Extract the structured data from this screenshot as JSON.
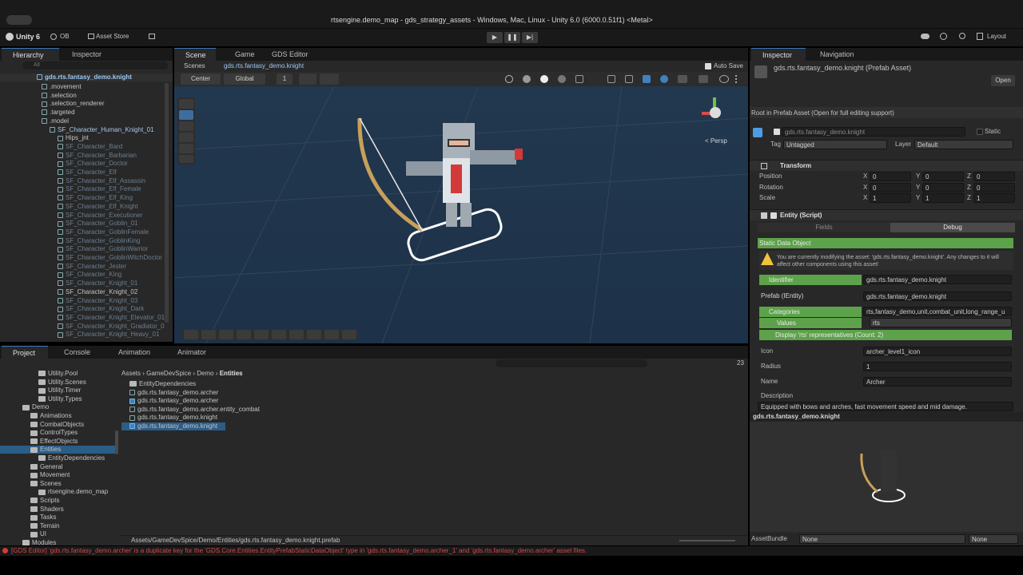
{
  "window": {
    "title": "rtsengine.demo_map - gds_strategy_assets - Windows, Mac, Linux - Unity 6.0 (6000.0.51f1) <Metal>"
  },
  "toolbar": {
    "unity_label": "Unity 6",
    "account": "OB",
    "asset_store": "Asset Store",
    "layout": "Layout"
  },
  "left_tabs": {
    "hierarchy": "Hierarchy",
    "inspector": "Inspector"
  },
  "hierarchy": {
    "search_placeholder": "All",
    "root": "gds.rts.fantasy_demo.knight",
    "items": [
      {
        "label": ".movement",
        "indent": 1,
        "style": "normal"
      },
      {
        "label": ".selection",
        "indent": 1,
        "style": "normal"
      },
      {
        "label": ".selection_renderer",
        "indent": 1,
        "style": "normal"
      },
      {
        "label": ".targeted",
        "indent": 1,
        "style": "normal"
      },
      {
        "label": ".model",
        "indent": 1,
        "style": "normal"
      },
      {
        "label": "SF_Character_Human_Knight_01",
        "indent": 2,
        "style": "blue"
      },
      {
        "label": "Hips_jnt",
        "indent": 3,
        "style": "normal"
      },
      {
        "label": "SF_Character_Bard",
        "indent": 3,
        "style": "faded"
      },
      {
        "label": "SF_Character_Barbarian",
        "indent": 3,
        "style": "faded"
      },
      {
        "label": "SF_Character_Doctor",
        "indent": 3,
        "style": "faded"
      },
      {
        "label": "SF_Character_Elf",
        "indent": 3,
        "style": "faded"
      },
      {
        "label": "SF_Character_Elf_Assassin",
        "indent": 3,
        "style": "faded"
      },
      {
        "label": "SF_Character_Elf_Female",
        "indent": 3,
        "style": "faded"
      },
      {
        "label": "SF_Character_Elf_King",
        "indent": 3,
        "style": "faded"
      },
      {
        "label": "SF_Character_Elf_Knight",
        "indent": 3,
        "style": "faded"
      },
      {
        "label": "SF_Character_Executioner",
        "indent": 3,
        "style": "faded"
      },
      {
        "label": "SF_Character_Goblin_01",
        "indent": 3,
        "style": "faded"
      },
      {
        "label": "SF_Character_GoblinFemale",
        "indent": 3,
        "style": "faded"
      },
      {
        "label": "SF_Character_GoblinKing",
        "indent": 3,
        "style": "faded"
      },
      {
        "label": "SF_Character_GoblinWarrior",
        "indent": 3,
        "style": "faded"
      },
      {
        "label": "SF_Character_GoblinWitchDoctor",
        "indent": 3,
        "style": "faded"
      },
      {
        "label": "SF_Character_Jester",
        "indent": 3,
        "style": "faded"
      },
      {
        "label": "SF_Character_King",
        "indent": 3,
        "style": "faded"
      },
      {
        "label": "SF_Character_Knight_01",
        "indent": 3,
        "style": "faded"
      },
      {
        "label": "SF_Character_Knight_02",
        "indent": 3,
        "style": "normal"
      },
      {
        "label": "SF_Character_Knight_03",
        "indent": 3,
        "style": "faded"
      },
      {
        "label": "SF_Character_Knight_Dark",
        "indent": 3,
        "style": "faded"
      },
      {
        "label": "SF_Character_Knight_Elevator_01",
        "indent": 3,
        "style": "faded"
      },
      {
        "label": "SF_Character_Knight_Gradiator_01",
        "indent": 3,
        "style": "faded"
      },
      {
        "label": "SF_Character_Knight_Heavy_01",
        "indent": 3,
        "style": "faded"
      }
    ]
  },
  "scene_tabs": {
    "scene": "Scene",
    "game": "Game",
    "gds_editor": "GDS Editor"
  },
  "scene": {
    "breadcrumb_scenes": "Scenes",
    "breadcrumb_asset": "gds.rts.fantasy_demo.knight",
    "auto_save": "Auto Save",
    "pivot": "Center",
    "space": "Global",
    "grid_value": "1",
    "persp": "< Persp"
  },
  "bottom_tabs": {
    "project": "Project",
    "console": "Console",
    "animation": "Animation",
    "animator": "Animator"
  },
  "project": {
    "badge": "23",
    "breadcrumb": [
      "Assets",
      "GameDevSpice",
      "Demo",
      "Entities"
    ],
    "tree": [
      {
        "label": "Utility.Pool",
        "indent": 3
      },
      {
        "label": "Utility.Scenes",
        "indent": 3
      },
      {
        "label": "Utility.Timer",
        "indent": 3
      },
      {
        "label": "Utility.Types",
        "indent": 3
      },
      {
        "label": "Demo",
        "indent": 1
      },
      {
        "label": "Animations",
        "indent": 2
      },
      {
        "label": "CombatObjects",
        "indent": 2
      },
      {
        "label": "ControlTypes",
        "indent": 2
      },
      {
        "label": "EffectObjects",
        "indent": 2
      },
      {
        "label": "Entities",
        "indent": 2,
        "selected": true
      },
      {
        "label": "EntityDependencies",
        "indent": 3
      },
      {
        "label": "General",
        "indent": 2
      },
      {
        "label": "Movement",
        "indent": 2
      },
      {
        "label": "Scenes",
        "indent": 2
      },
      {
        "label": "rtsengine.demo_map",
        "indent": 3
      },
      {
        "label": "Scripts",
        "indent": 2
      },
      {
        "label": "Shaders",
        "indent": 2
      },
      {
        "label": "Tasks",
        "indent": 2
      },
      {
        "label": "Terrain",
        "indent": 2
      },
      {
        "label": "UI",
        "indent": 2
      },
      {
        "label": "Modules",
        "indent": 1
      }
    ],
    "files": [
      {
        "label": "EntityDependencies",
        "kind": "folder"
      },
      {
        "label": "gds.rts.fantasy_demo.archer",
        "kind": "asset"
      },
      {
        "label": "gds.rts.fantasy_demo.archer",
        "kind": "prefab"
      },
      {
        "label": "gds.rts.fantasy_demo.archer.entity_combat",
        "kind": "asset"
      },
      {
        "label": "gds.rts.fantasy_demo.knight",
        "kind": "asset"
      },
      {
        "label": "gds.rts.fantasy_demo.knight",
        "kind": "prefab",
        "selected": true
      }
    ],
    "path": "Assets/GameDevSpice/Demo/Entities/gds.rts.fantasy_demo.knight.prefab"
  },
  "status": {
    "error": "[GDS Editor] 'gds.rts.fantasy_demo.archer' is a duplicate key for the 'GDS.Core.Entities.EntityPrefabStaticDataObject' type in 'gds.rts.fantasy_demo.archer_1' and 'gds.rts.fantasy_demo.archer' asset files."
  },
  "right_tabs": {
    "inspector": "Inspector",
    "navigation": "Navigation"
  },
  "inspector": {
    "asset_title": "gds.rts.fantasy_demo.knight (Prefab Asset)",
    "open_button": "Open",
    "root_note": "Root in Prefab Asset (Open for full editing support)",
    "object_name": "gds.rts.fantasy_demo.knight",
    "static_label": "Static",
    "tag_label": "Tag",
    "tag_value": "Untagged",
    "layer_label": "Layer",
    "layer_value": "Default",
    "transform": {
      "title": "Transform",
      "rows": [
        {
          "label": "Position",
          "x": "0",
          "y": "0",
          "z": "0"
        },
        {
          "label": "Rotation",
          "x": "0",
          "y": "0",
          "z": "0"
        },
        {
          "label": "Scale",
          "x": "1",
          "y": "1",
          "z": "1"
        }
      ],
      "axis_x": "X",
      "axis_y": "Y",
      "axis_z": "Z"
    },
    "entity": {
      "title": "Entity (Script)",
      "tab_fields": "Fields",
      "tab_debug": "Debug",
      "section": "Static Data Object",
      "warning": "You are currently modifying the asset: 'gds.rts.fantasy_demo.knight'. Any changes to it will affect other components using this asset!",
      "identifier_label": "Identifier",
      "identifier_value": "gds.rts.fantasy_demo.knight",
      "prefab_label": "Prefab (IEntity)",
      "prefab_value": "gds.rts.fantasy_demo.knight",
      "categories_label": "Categories",
      "categories_value": "rts,fantasy_demo,unit,combat_unit,long_range_u",
      "values_label": "Values",
      "values_value": "rts",
      "display_rts": "Display 'rts' representatives (Count: 2)",
      "icon_label": "Icon",
      "icon_value": "archer_level1_icon",
      "radius_label": "Radius",
      "radius_value": "1",
      "name_label": "Name",
      "name_value": "Archer",
      "description_label": "Description",
      "description_value": "Equipped with bows and arches, fast movement speed and mid damage."
    },
    "preview_title": "gds.rts.fantasy_demo.knight",
    "assetbundle_label": "AssetBundle",
    "assetbundle_value": "None",
    "assetbundle_variant": "None"
  }
}
